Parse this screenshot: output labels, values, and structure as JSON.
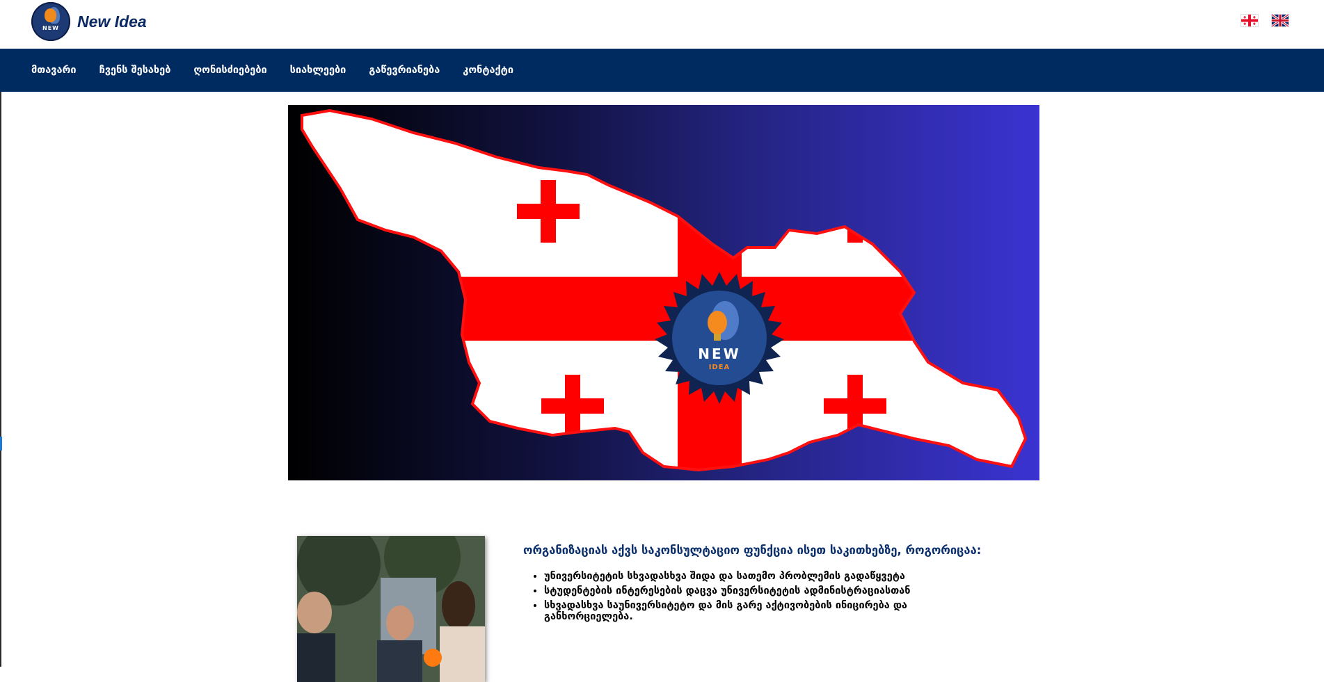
{
  "header": {
    "logo_text": "New Idea",
    "logo_badge_text": "NEW",
    "languages": [
      "georgian-flag-icon",
      "uk-flag-icon"
    ]
  },
  "nav": {
    "items": [
      {
        "label": "მთავარი"
      },
      {
        "label": "ჩვენს შესახებ"
      },
      {
        "label": "ღონისძიებები"
      },
      {
        "label": "სიახლეები"
      },
      {
        "label": "გაწევრიანება"
      },
      {
        "label": "კონტაქტი"
      }
    ]
  },
  "hero": {
    "badge_top": "NEW",
    "badge_bottom": "IDEA",
    "colors": {
      "flag_red": "#ff0000",
      "badge": "#16305f",
      "bg_start": "#000000",
      "bg_end": "#3b33d2"
    }
  },
  "content": {
    "heading": "ორგანიზაციას აქვს საკონსულტაციო ფუნქცია ისეთ საკითხებზე, როგორიცაა:",
    "bullets": [
      "უნივერსიტეტის სხვადასხვა შიდა და სათემო პრობლემის გადაწყვეტა",
      "სტუდენტების ინტერესების დაცვა უნივერსიტეტის ადმინისტრაციასთან",
      "სხვადასხვა საუნივერსიტეტო და მის გარე აქტივობების ინიცირება და განხორციელება."
    ]
  },
  "colors": {
    "nav_bg": "#002b61",
    "heading": "#0b2f6b",
    "logo_text": "#0b2a63"
  }
}
